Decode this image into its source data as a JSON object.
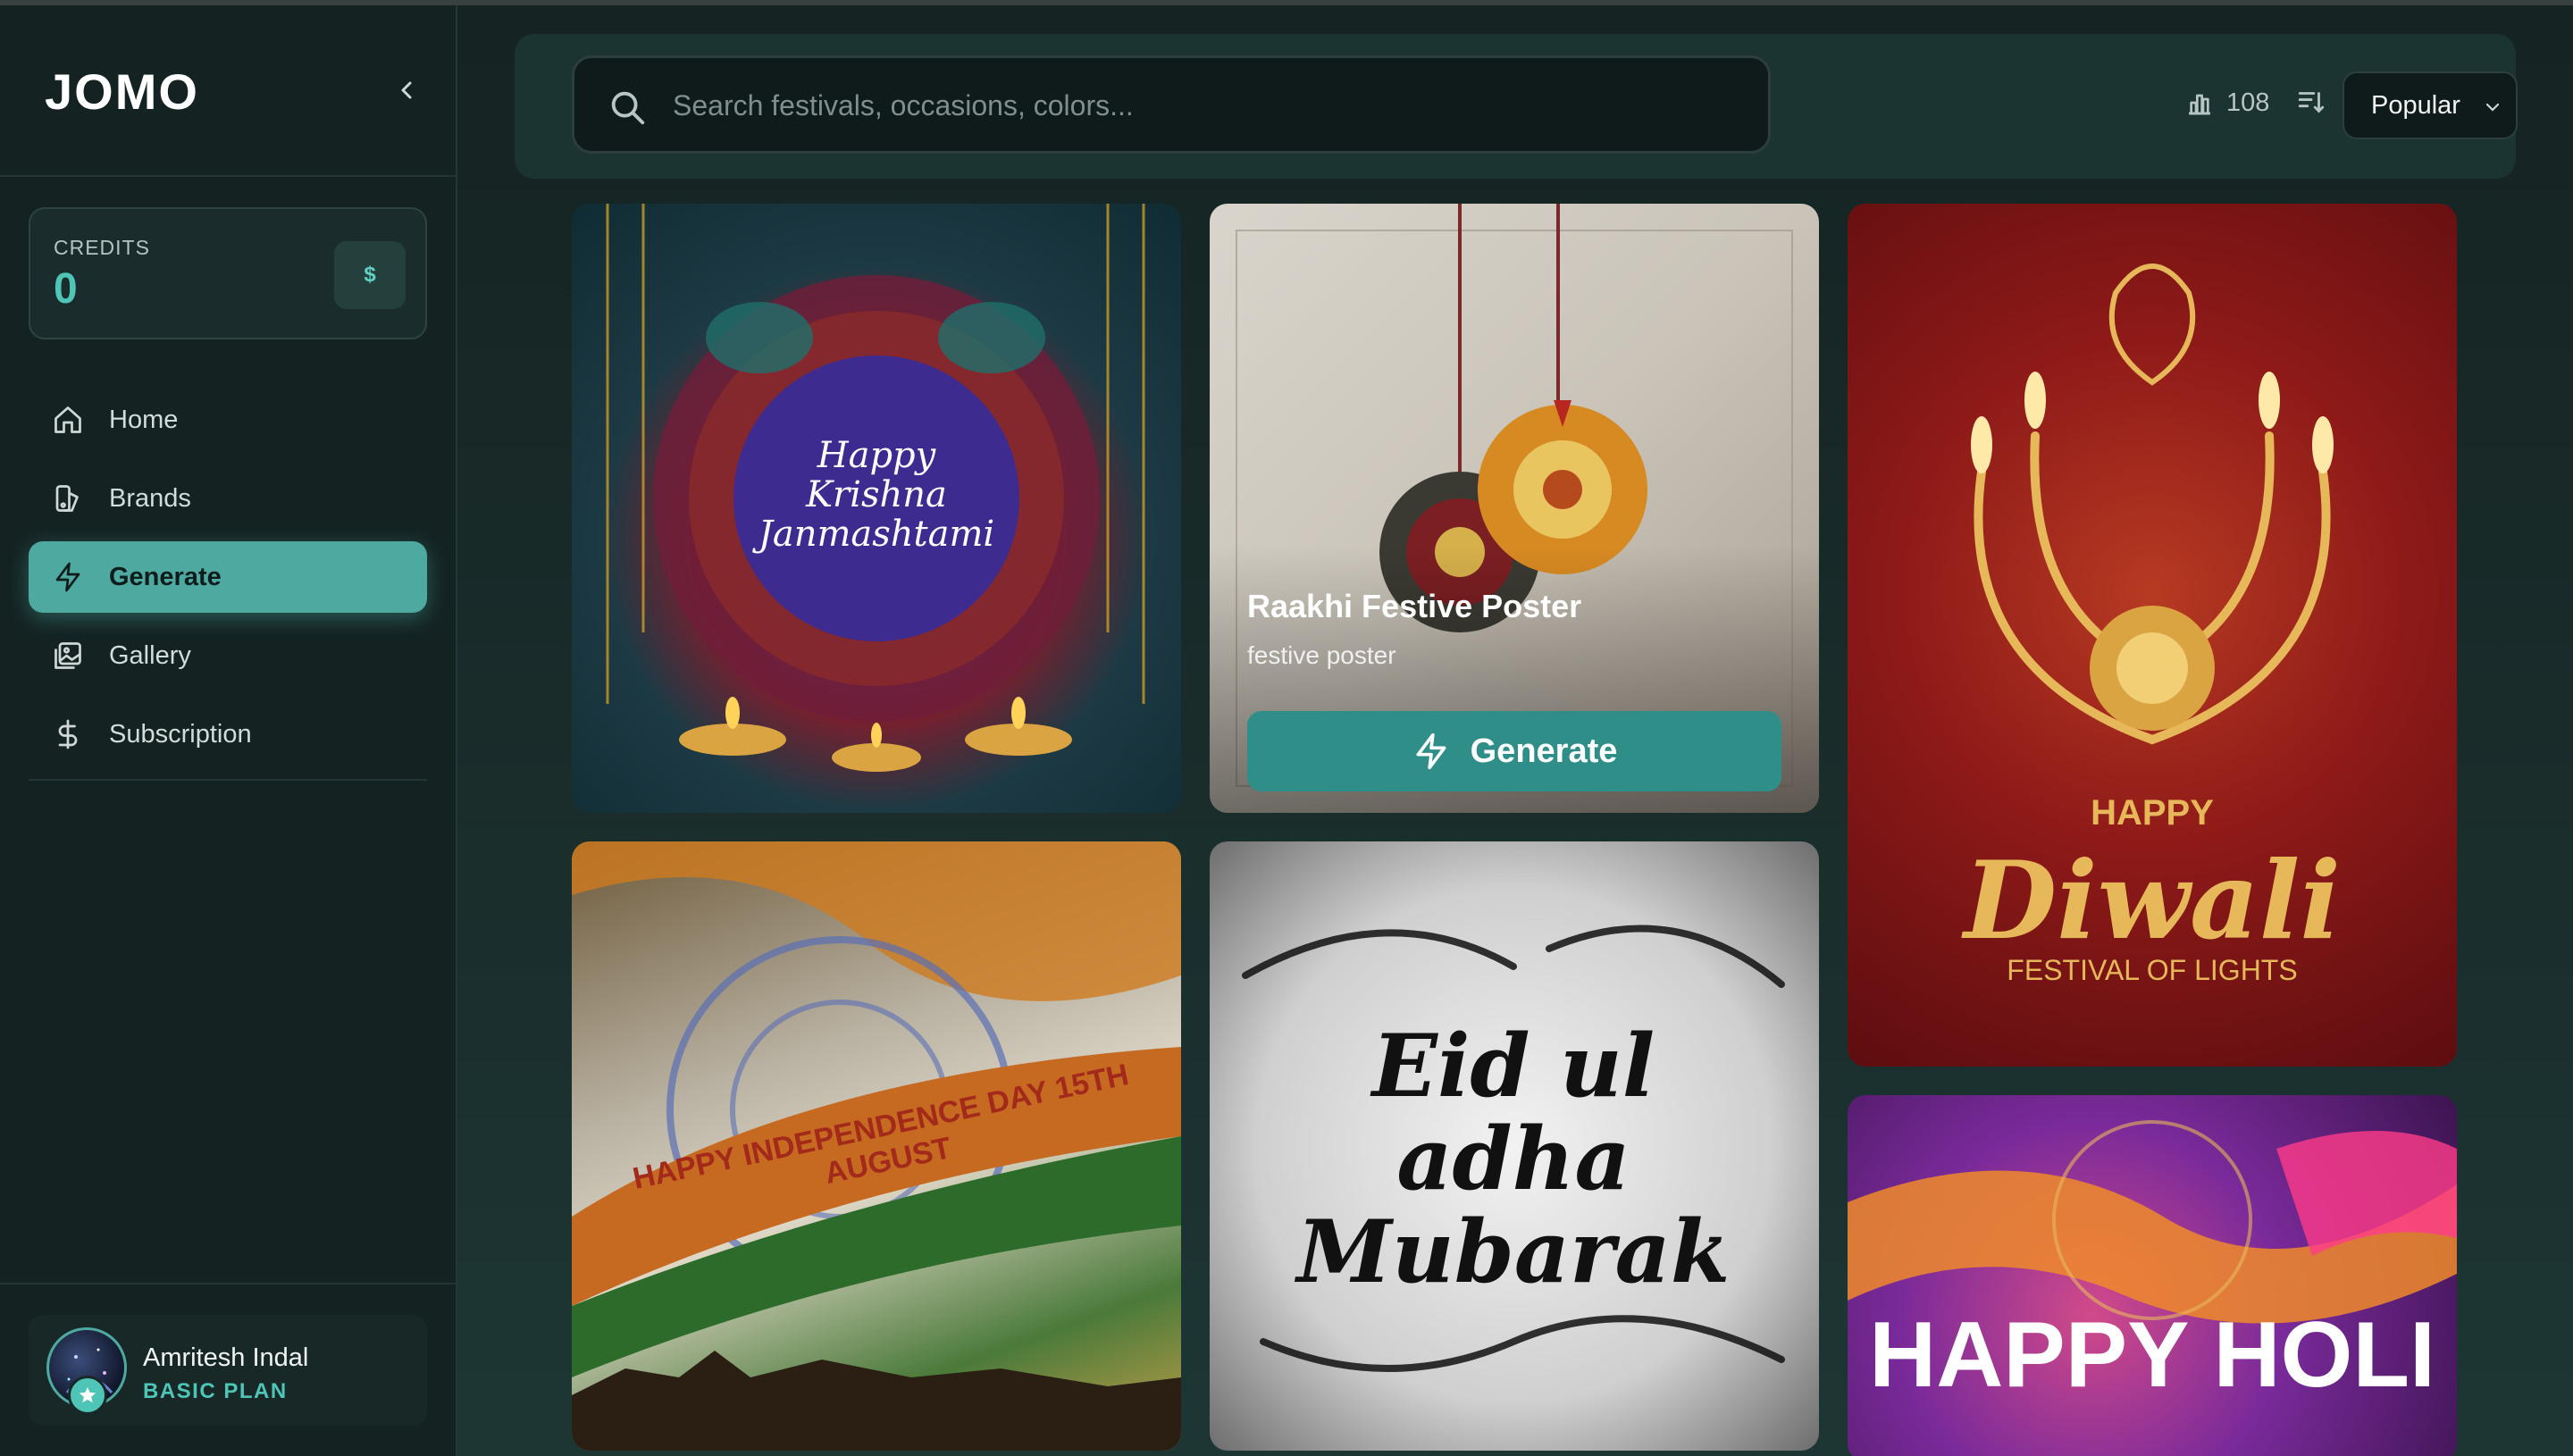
{
  "app": {
    "logo": "JOMO"
  },
  "sidebar": {
    "credits_label": "CREDITS",
    "credits_value": "0",
    "credits_button": "$",
    "items": [
      {
        "label": "Home",
        "icon": "home-icon"
      },
      {
        "label": "Brands",
        "icon": "brands-icon"
      },
      {
        "label": "Generate",
        "icon": "bolt-icon",
        "active": true
      },
      {
        "label": "Gallery",
        "icon": "gallery-icon"
      },
      {
        "label": "Subscription",
        "icon": "dollar-icon"
      }
    ],
    "user": {
      "name": "Amritesh Indal",
      "plan": "BASIC PLAN"
    }
  },
  "toolbar": {
    "search_placeholder": "Search festivals, occasions, colors...",
    "count": "108",
    "sort_selected": "Popular"
  },
  "cards": {
    "krishna": {
      "text": "Happy Krishna Janmashtami"
    },
    "rakhi": {
      "title": "Raakhi Festive Poster",
      "subtitle": "festive poster",
      "button": "Generate"
    },
    "diwali": {
      "happy": "HAPPY",
      "name": "Diwali",
      "tagline": "FESTIVAL OF LIGHTS"
    },
    "independence": {
      "text": "HAPPY INDEPENDENCE DAY 15TH AUGUST"
    },
    "eid": {
      "text": "Eid ul adha Mubarak"
    },
    "holi": {
      "text": "HAPPY HOLI"
    }
  },
  "colors": {
    "accent": "#4ea9a0",
    "sidebar_bg": "#142222",
    "main_bg": "#1a2e2c"
  }
}
